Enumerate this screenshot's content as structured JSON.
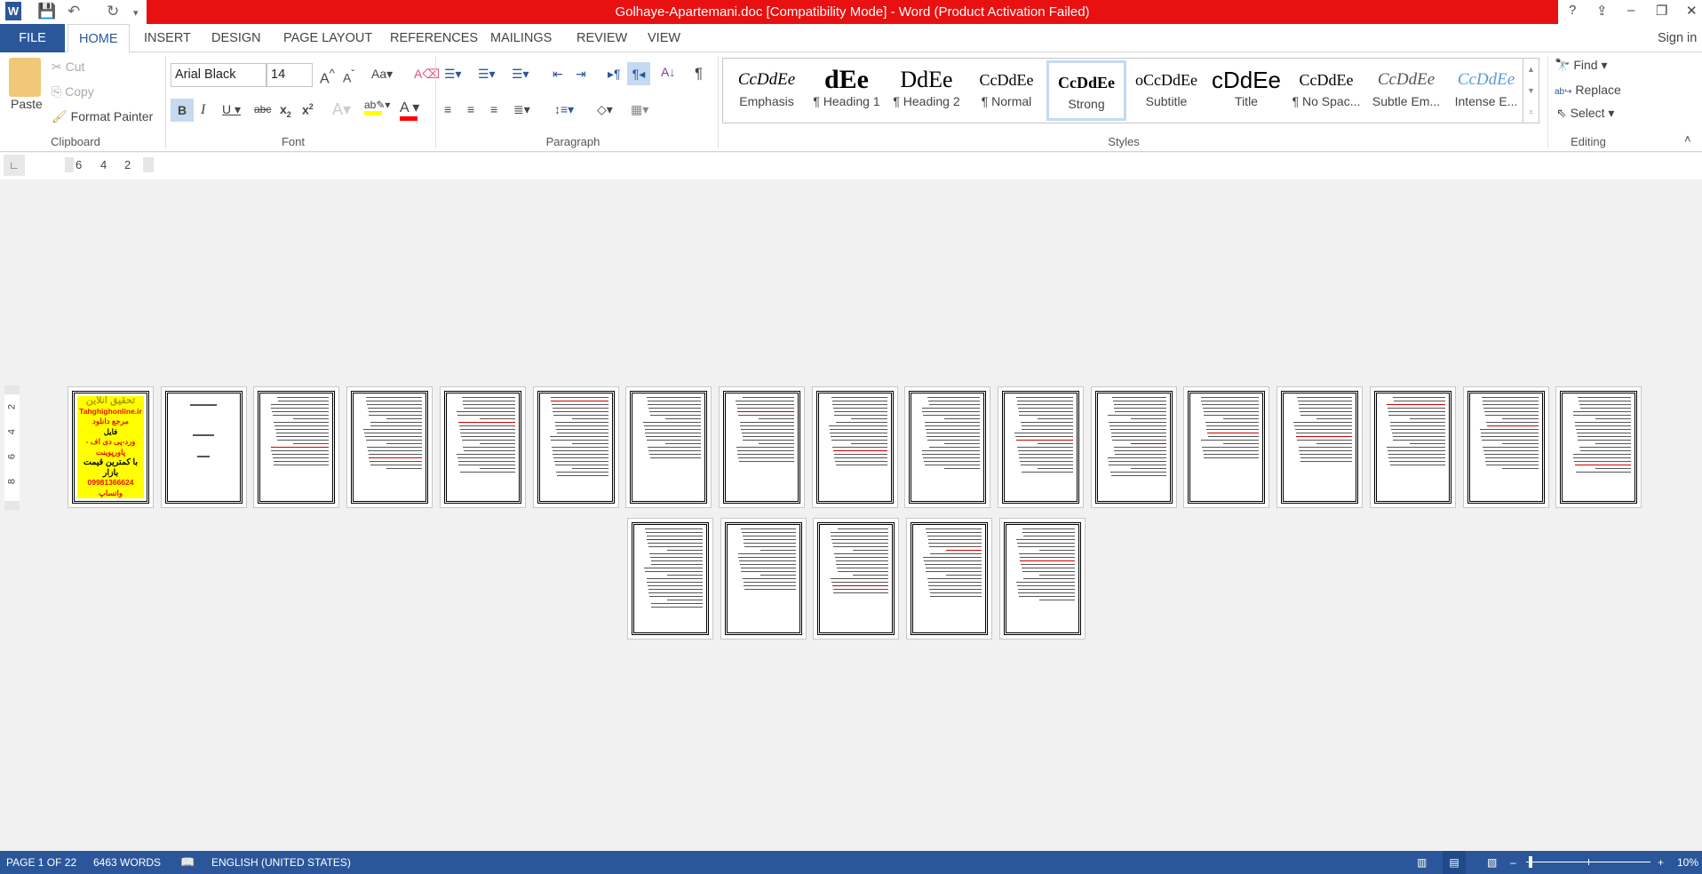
{
  "window": {
    "title": "Golhaye-Apartemani.doc [Compatibility Mode] -  Word (Product Activation Failed)",
    "help": "?",
    "controls": [
      "⇪",
      "–",
      "❐",
      "✕"
    ],
    "sign_in": "Sign in"
  },
  "quick_access": {
    "app_icon": "word-icon",
    "save": "💾",
    "undo": "↶",
    "redo": "↻"
  },
  "tabs": [
    "FILE",
    "HOME",
    "INSERT",
    "DESIGN",
    "PAGE LAYOUT",
    "REFERENCES",
    "MAILINGS",
    "REVIEW",
    "VIEW"
  ],
  "ribbon": {
    "clipboard": {
      "label": "Clipboard",
      "paste": "Paste",
      "cut": "Cut",
      "copy": "Copy",
      "format_painter": "Format Painter"
    },
    "font": {
      "label": "Font",
      "name": "Arial Black",
      "size": "14",
      "highlight_color": "#ffff00",
      "font_color": "#ff0000"
    },
    "paragraph": {
      "label": "Paragraph"
    },
    "styles": {
      "label": "Styles",
      "items": [
        {
          "preview": "CcDdEe",
          "name": "Emphasis"
        },
        {
          "preview": "dEe",
          "name": "¶ Heading 1"
        },
        {
          "preview": "DdEe",
          "name": "¶ Heading 2"
        },
        {
          "preview": "CcDdEe",
          "name": "¶ Normal"
        },
        {
          "preview": "CcDdEe",
          "name": "Strong"
        },
        {
          "preview": "oCcDdEe",
          "name": "Subtitle"
        },
        {
          "preview": "cDdEe",
          "name": "Title"
        },
        {
          "preview": "CcDdEe",
          "name": "¶ No Spac..."
        },
        {
          "preview": "CcDdEe",
          "name": "Subtle Em..."
        },
        {
          "preview": "CcDdEe",
          "name": "Intense E..."
        }
      ],
      "selected": "Strong"
    },
    "editing": {
      "label": "Editing",
      "find": "Find",
      "replace": "Replace",
      "select": "Select"
    }
  },
  "ruler": {
    "tab_selector": "∟",
    "marks": [
      "6",
      "4",
      "2"
    ],
    "vertical_marks": [
      "2",
      "4",
      "6",
      "8"
    ]
  },
  "document": {
    "page_count": 22,
    "cover": {
      "title": "تحقیق آنلاین",
      "site": "Tahghighonline.ir",
      "l1": "مرجع دانلود",
      "l2": "فایل",
      "l3": "ورد-پی دی اف - پاورپوینت",
      "l4": "با کمترین قیمت بازار",
      "l5": "09981366624 واتساپ"
    }
  },
  "status": {
    "page": "PAGE 1 OF 22",
    "words": "6463 WORDS",
    "language": "ENGLISH (UNITED STATES)",
    "zoom": "10%",
    "zoom_level_percent": 10
  }
}
